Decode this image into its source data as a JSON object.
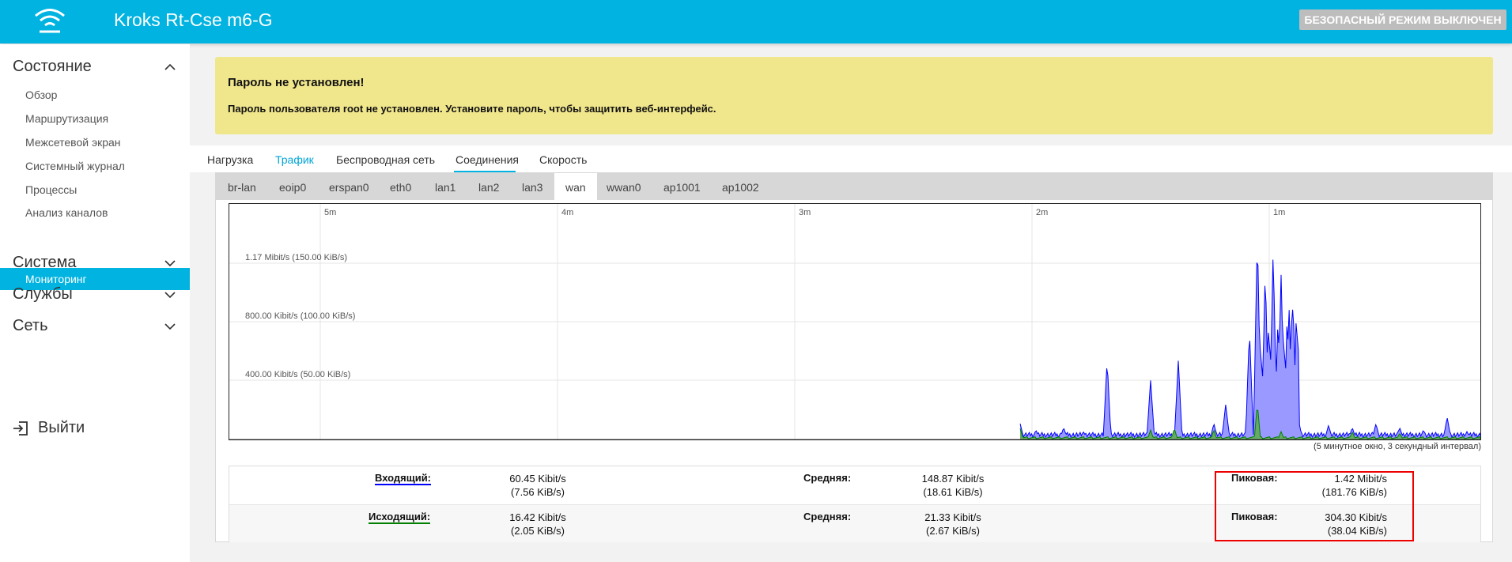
{
  "header": {
    "title": "Kroks Rt-Cse m6-G",
    "safe_mode_button": "БЕЗОПАСНЫЙ РЕЖИМ ВЫКЛЮЧЕН"
  },
  "sidebar": {
    "status": "Состояние",
    "status_items": [
      "Обзор",
      "Маршрутизация",
      "Межсетевой экран",
      "Системный журнал",
      "Процессы",
      "Анализ каналов",
      "Мониторинг"
    ],
    "system": "Система",
    "services": "Службы",
    "network": "Сеть",
    "logout": "Выйти"
  },
  "alert": {
    "title": "Пароль не установлен!",
    "message": "Пароль пользователя root не установлен. Установите пароль, чтобы защитить веб-интерфейс."
  },
  "tabs": [
    "Нагрузка",
    "Трафик",
    "Беспроводная сеть",
    "Соединения",
    "Скорость"
  ],
  "active_tab": "Трафик",
  "interfaces": [
    "br-lan",
    "eoip0",
    "erspan0",
    "eth0",
    "lan1",
    "lan2",
    "lan3",
    "wan",
    "wwan0",
    "ap1001",
    "ap1002"
  ],
  "active_interface": "wan",
  "graph": {
    "time_labels": [
      "5m",
      "4m",
      "3m",
      "2m",
      "1m"
    ],
    "y_labels": [
      "1.17 Mibit/s (150.00 KiB/s)",
      "800.00 Kibit/s (100.00 KiB/s)",
      "400.00 Kibit/s (50.00 KiB/s)"
    ],
    "caption": "(5 минутное окно, 3 секундный интервал)",
    "colors": {
      "inbound": "#0000ff",
      "inbound_fill": "#9999ff",
      "outbound": "#008000",
      "outbound_fill": "#66aa66"
    }
  },
  "stats": {
    "inbound_label": "Входящий:",
    "inbound_value": "60.45 Kibit/s",
    "inbound_value_bytes": "(7.56 KiB/s)",
    "inbound_avg_label": "Средняя:",
    "inbound_avg": "148.87 Kibit/s",
    "inbound_avg_bytes": "(18.61 KiB/s)",
    "inbound_peak_label": "Пиковая:",
    "inbound_peak": "1.42 Mibit/s",
    "inbound_peak_bytes": "(181.76 KiB/s)",
    "outbound_label": "Исходящий:",
    "outbound_value": "16.42 Kibit/s",
    "outbound_value_bytes": "(2.05 KiB/s)",
    "outbound_avg_label": "Средняя:",
    "outbound_avg": "21.33 Kibit/s",
    "outbound_avg_bytes": "(2.67 KiB/s)",
    "outbound_peak_label": "Пиковая:",
    "outbound_peak": "304.30 Kibit/s",
    "outbound_peak_bytes": "(38.04 KiB/s)"
  }
}
